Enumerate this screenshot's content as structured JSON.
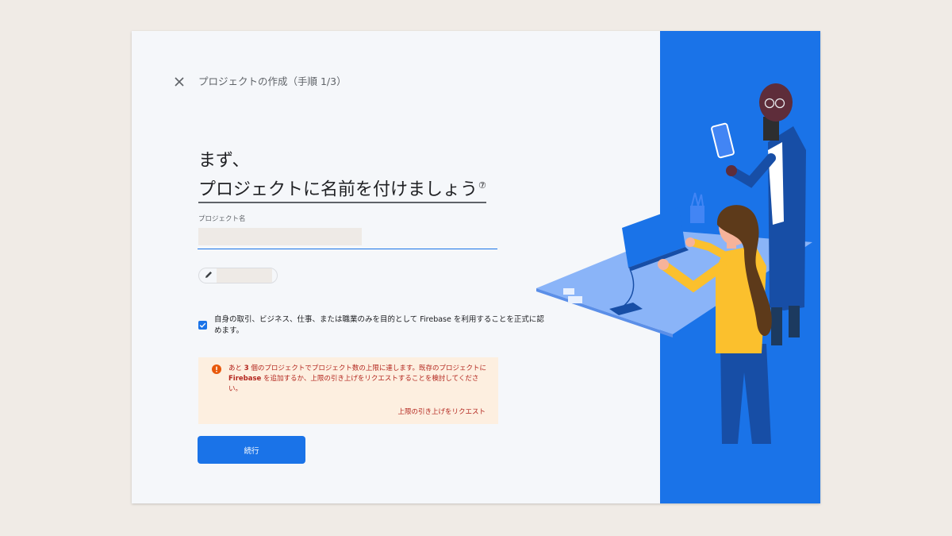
{
  "header": {
    "close_icon": "close-icon",
    "title": "プロジェクトの作成（手順 1/3）"
  },
  "headline": {
    "line1": "まず、",
    "line2": "プロジェクトに名前を付けましょう",
    "help_icon": "help-icon"
  },
  "project_name_field": {
    "label": "プロジェクト名",
    "value": ""
  },
  "project_id_chip": {
    "icon": "pencil-icon",
    "value": ""
  },
  "terms": {
    "checked": true,
    "text": "自身の取引、ビジネス、仕事、または職業のみを目的として Firebase を利用することを正式に認めます。"
  },
  "warning": {
    "icon": "error-icon",
    "text_part1": "あと ",
    "count": "3",
    "text_part2": " 個のプロジェクトでプロジェクト数の上限に達します。既存のプロジェクトに ",
    "product": "Firebase",
    "text_part3": " を追加するか、上限の引き上げをリクエストすることを検討してください。",
    "link": "上限の引き上げをリクエスト"
  },
  "continue_button": {
    "label": "続行"
  },
  "colors": {
    "primary": "#1a73e8",
    "panel_bg": "#f5f7fa",
    "page_bg": "#f0ebe6",
    "warning_bg": "#fdefe0",
    "warning_text": "#b3261e",
    "warning_icon": "#e8590c",
    "illustration_bg": "#1a73e8"
  }
}
